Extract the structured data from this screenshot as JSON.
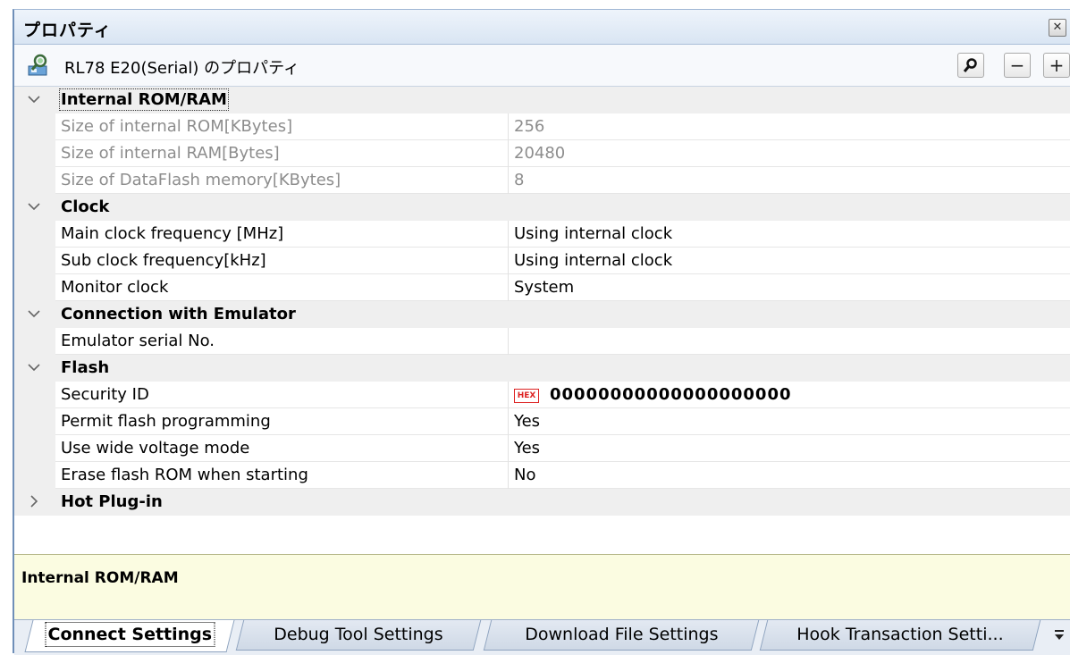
{
  "window": {
    "title": "プロパティ"
  },
  "toolbar": {
    "target_title": "RL78 E20(Serial) のプロパティ",
    "search_icon": "magnifier-icon",
    "collapse_label": "−",
    "expand_label": "+"
  },
  "grid": {
    "categories": [
      {
        "label": "Internal ROM/RAM",
        "expanded": true,
        "properties": [
          {
            "name": "Size of internal ROM[KBytes]",
            "value": "256",
            "disabled": true
          },
          {
            "name": "Size of internal RAM[Bytes]",
            "value": "20480",
            "disabled": true
          },
          {
            "name": "Size of DataFlash memory[KBytes]",
            "value": "8",
            "disabled": true
          }
        ]
      },
      {
        "label": "Clock",
        "expanded": true,
        "properties": [
          {
            "name": "Main clock frequency [MHz]",
            "value": "Using internal clock"
          },
          {
            "name": "Sub clock frequency[kHz]",
            "value": "Using internal clock"
          },
          {
            "name": "Monitor clock",
            "value": "System"
          }
        ]
      },
      {
        "label": "Connection with Emulator",
        "expanded": true,
        "properties": [
          {
            "name": "Emulator serial No.",
            "value": ""
          }
        ]
      },
      {
        "label": "Flash",
        "expanded": true,
        "properties": [
          {
            "name": "Security ID",
            "value": "00000000000000000000",
            "badge": "HEX"
          },
          {
            "name": "Permit flash programming",
            "value": "Yes"
          },
          {
            "name": "Use wide voltage mode",
            "value": "Yes"
          },
          {
            "name": "Erase flash ROM when starting",
            "value": "No"
          }
        ]
      },
      {
        "label": "Hot Plug-in",
        "expanded": false,
        "properties": []
      }
    ]
  },
  "description": {
    "title": "Internal ROM/RAM"
  },
  "tabs": [
    {
      "label": "Connect Settings",
      "active": true
    },
    {
      "label": "Debug Tool Settings",
      "active": false
    },
    {
      "label": "Download File Settings",
      "active": false
    },
    {
      "label": "Hook Transaction Setti...",
      "active": false
    }
  ],
  "colors": {
    "category_bg": "#efefef",
    "description_bg": "#fbfce1",
    "titlebar_bg": "#d9e5f3",
    "hex_badge": "#dd2222"
  }
}
